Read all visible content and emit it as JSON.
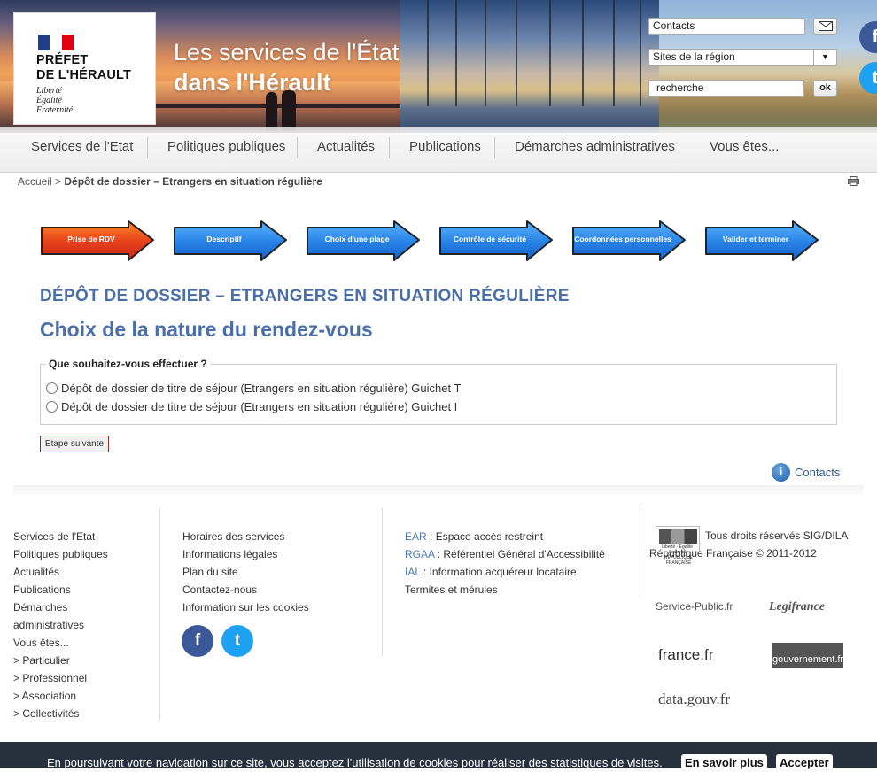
{
  "header": {
    "logo": {
      "title_line1": "PRÉFET",
      "title_line2": "DE L'HÉRAULT",
      "motto": [
        "Liberté",
        "Égalité",
        "Fraternité"
      ]
    },
    "site_title_line1": "Les services de l'État",
    "site_title_line2": "dans l'Hérault",
    "contacts_field": "Contacts",
    "region_select": "Sites de la région",
    "search_field": "recherche",
    "search_button": "ok",
    "social": {
      "facebook": "f",
      "twitter": "t"
    }
  },
  "nav": {
    "items": [
      "Services de l'Etat",
      "Politiques publiques",
      "Actualités",
      "Publications",
      "Démarches administratives",
      "Vous êtes..."
    ]
  },
  "breadcrumb": {
    "home": "Accueil",
    "separator": ">",
    "current": "Dépôt de dossier – Etrangers en situation régulière"
  },
  "steps": [
    {
      "label": "Prise de RDV",
      "state": "active",
      "color": "#e8441c"
    },
    {
      "label": "Descriptif",
      "state": "todo",
      "color": "#2a86e8"
    },
    {
      "label": "Choix d'une plage",
      "state": "todo",
      "color": "#2a86e8"
    },
    {
      "label": "Contrôle de sécurité",
      "state": "todo",
      "color": "#2a86e8"
    },
    {
      "label": "Coordonnées personnelles",
      "state": "todo",
      "color": "#2a86e8"
    },
    {
      "label": "Valider et terminer",
      "state": "todo",
      "color": "#2a86e8"
    }
  ],
  "main": {
    "heading": "DÉPÔT DE DOSSIER – ETRANGERS EN SITUATION RÉGULIÈRE",
    "subheading": "Choix de la nature du rendez-vous",
    "question": "Que souhaitez-vous effectuer ?",
    "options": [
      "Dépôt de dossier de titre de séjour (Etrangers en situation régulière) Guichet T",
      "Dépôt de dossier de titre de séjour (Etrangers en situation régulière) Guichet I"
    ],
    "next_button": "Etape suivante",
    "contacts_link": "Contacts"
  },
  "footer": {
    "col1": [
      "Services de l'Etat",
      "Politiques publiques",
      "Actualités",
      "Publications",
      "Démarches",
      "administratives",
      "Vous êtes...",
      "> Particulier",
      "> Professionnel",
      "> Association",
      "> Collectivités"
    ],
    "col2": [
      "Horaires des services",
      "Informations légales",
      "Plan du site",
      "Contactez-nous",
      "Information sur les cookies"
    ],
    "col3": [
      {
        "acronym": "EAR",
        "text": " : Espace accès restreint"
      },
      {
        "acronym": "RGAA",
        "text": " : Référentiel Général d'Accessibilité"
      },
      {
        "acronym": "IAL",
        "text": " : Information acquéreur locataire"
      },
      {
        "acronym": "",
        "text": "Termites et mérules"
      }
    ],
    "copyright": "Tous droits réservés SIG/DILA République Française © 2011-2012",
    "rf_logo_caption": "Liberté · Égalité · Fraternité RÉPUBLIQUE FRANÇAISE",
    "partners": [
      "Service-Public.fr",
      "Legifrance",
      "france.fr",
      "gouvernement.fr",
      "data.gouv.fr"
    ]
  },
  "cookie_bar": {
    "text": "En poursuivant votre navigation sur ce site, vous acceptez l'utilisation de cookies pour réaliser des statistiques de visites.",
    "more_button": "En savoir plus",
    "accept_button": "Accepter"
  },
  "colors": {
    "accent": "#4a6ea8",
    "link": "#2e5e9a",
    "facebook": "#3b5998",
    "twitter": "#1da1f2",
    "cookie_bg": "#27313d"
  }
}
